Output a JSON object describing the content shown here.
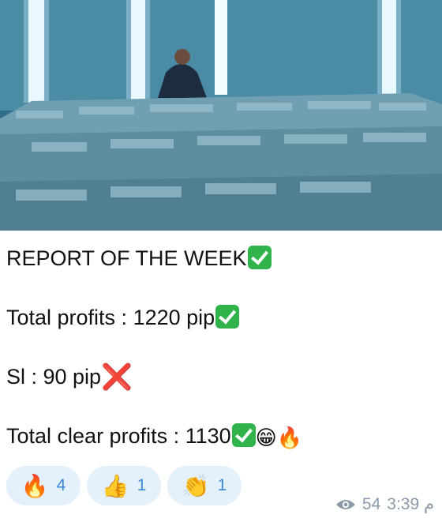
{
  "message": {
    "line1_text": "REPORT OF THE WEEK",
    "line2_text": "Total profits : 1220 pip",
    "line3_text": "Sl : 90 pip",
    "line3_mark": "❌",
    "line4_text": "Total clear profits : 1130",
    "line4_emoji1": "😁",
    "line4_emoji2": "🔥"
  },
  "reactions": [
    {
      "emoji": "🔥",
      "icon": "fire-icon",
      "count": "4"
    },
    {
      "emoji": "👍",
      "icon": "thumbs-up-icon",
      "count": "1"
    },
    {
      "emoji": "👏",
      "icon": "clapping-hands-icon",
      "count": "1"
    }
  ],
  "meta": {
    "views": "54",
    "time": "3:39 م"
  },
  "colors": {
    "reaction_bg": "#e4f0fb",
    "reaction_count": "#3a8ad6",
    "check_green": "#2fb34a",
    "cross_red": "#e0261d",
    "meta_gray": "#8a9aa8"
  }
}
